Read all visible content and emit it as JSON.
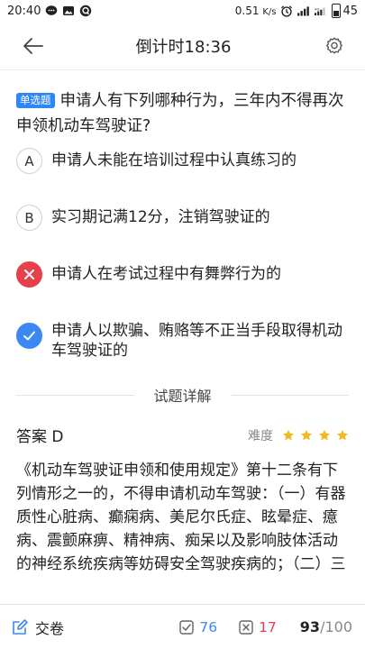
{
  "status_bar": {
    "time": "20:40",
    "net_speed": "0.51",
    "net_unit": "K/s",
    "battery": "45"
  },
  "header": {
    "title": "倒计时18:36"
  },
  "question": {
    "type_tag": "单选题",
    "text": "申请人有下列哪种行为，三年内不得再次申领机动车驾驶证?",
    "options": [
      {
        "key": "A",
        "text": "申请人未能在培训过程中认真练习的",
        "state": "normal"
      },
      {
        "key": "B",
        "text": "实习期记满12分，注销驾驶证的",
        "state": "normal"
      },
      {
        "key": "C",
        "text": "申请人在考试过程中有舞弊行为的",
        "state": "wrong"
      },
      {
        "key": "D",
        "text": "申请人以欺骗、贿赂等不正当手段取得机动车驾驶证的",
        "state": "correct"
      }
    ]
  },
  "detail": {
    "section_title": "试题详解",
    "answer_label": "答案 D",
    "difficulty_label": "难度",
    "difficulty_stars": 4,
    "explanation": "《机动车驾驶证申领和使用规定》第十二条有下列情形之一的，不得申请机动车驾驶：（一）有器质性心脏病、癫痫病、美尼尔氏症、眩晕症、癔病、震颤麻痹、精神病、痴呆以及影响肢体活动的神经系统疾病等妨碍安全驾驶疾病的；（二）三年内有吸食、注射毒品行为或者解除"
  },
  "bottom_bar": {
    "submit_label": "交卷",
    "correct_count": "76",
    "wrong_count": "17",
    "current": "93",
    "total": "/100"
  },
  "colors": {
    "accent": "#2f86f6",
    "wrong": "#e5414b",
    "star": "#f5b920"
  }
}
